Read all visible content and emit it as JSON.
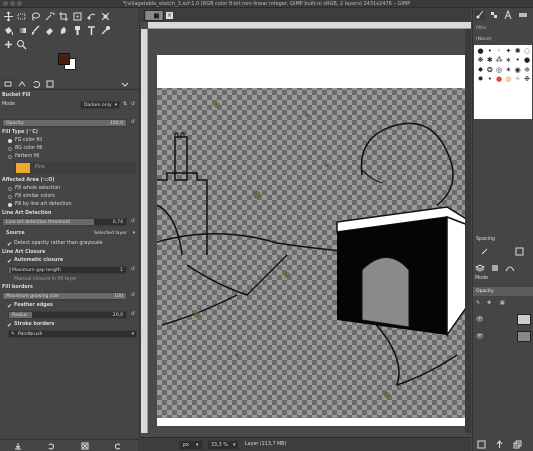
{
  "window": {
    "title": "*[villagetable_sketch_3.xcf-1.0 (RGB color 8-bit non-linear integer, GIMP built-in sRGB, 2 layers) 2431x2476 – GIMP"
  },
  "toolbox": {
    "tools": [
      "move-tool",
      "rect-select-tool",
      "lasso-tool",
      "fuzzy-select-tool",
      "crop-tool",
      "unified-transform-tool",
      "warp-transform-tool",
      "handle-transform-tool",
      "bucket-fill-tool",
      "gradient-tool",
      "paintbrush-tool",
      "eraser-tool",
      "smudge-tool",
      "clone-tool",
      "heal-tool",
      "text-tool",
      "color-picker-tool",
      "zoom-tool"
    ],
    "fg_color": "#4a1e12",
    "bg_color": "#ffffff"
  },
  "tool_options": {
    "title": "Bucket Fill",
    "mode_label": "Mode",
    "mode_value": "Darken only",
    "opacity_label": "Opacity",
    "opacity_value": "100,0",
    "opacity_fraction": 1.0,
    "fill_type_label": "Fill Type (⌃C)",
    "fill_types": [
      "FG color fill",
      "BG color fill",
      "Pattern fill"
    ],
    "fill_type_selected": 0,
    "pattern_name": "Pine",
    "affected_area_label": "Affected Area (⌥O)",
    "affected_areas": [
      "Fill whole selection",
      "Fill similar colors",
      "Fill by line art detection"
    ],
    "affected_area_selected": 2,
    "line_art_detection_label": "Line Art Detection",
    "line_art_threshold_label": "Line art detection threshold",
    "line_art_threshold_value": "0,74",
    "line_art_threshold_fraction": 0.74,
    "source_label": "Source",
    "source_value": "Selected layer",
    "detect_opacity_label": "Detect opacity rather than grayscale",
    "line_art_closure_label": "Line Art Closure",
    "automatic_closure_label": "Automatic closure",
    "max_gap_label": "Maximum gap length",
    "max_gap_value": "1",
    "manual_closure_label": "Manual closure in fill layer",
    "fill_borders_label": "Fill borders",
    "max_growing_label": "Maximum growing size",
    "max_growing_value": "100",
    "max_growing_fraction": 1.0,
    "feather_edges_label": "Feather edges",
    "radius_label": "Radius",
    "radius_value": "20,0",
    "radius_fraction": 0.2,
    "stroke_borders_label": "Stroke borders",
    "stroke_tool_value": "Paintbrush"
  },
  "status": {
    "unit": "px",
    "zoom": "33,3 %",
    "layer_info": "Layer (213,7 MB)"
  },
  "brushes": {
    "filter_label": "filter",
    "preset_label": "(None)",
    "spacing_label": "Spacing"
  },
  "layers": {
    "mode_label": "Mode",
    "opacity_label": "Opacity"
  }
}
